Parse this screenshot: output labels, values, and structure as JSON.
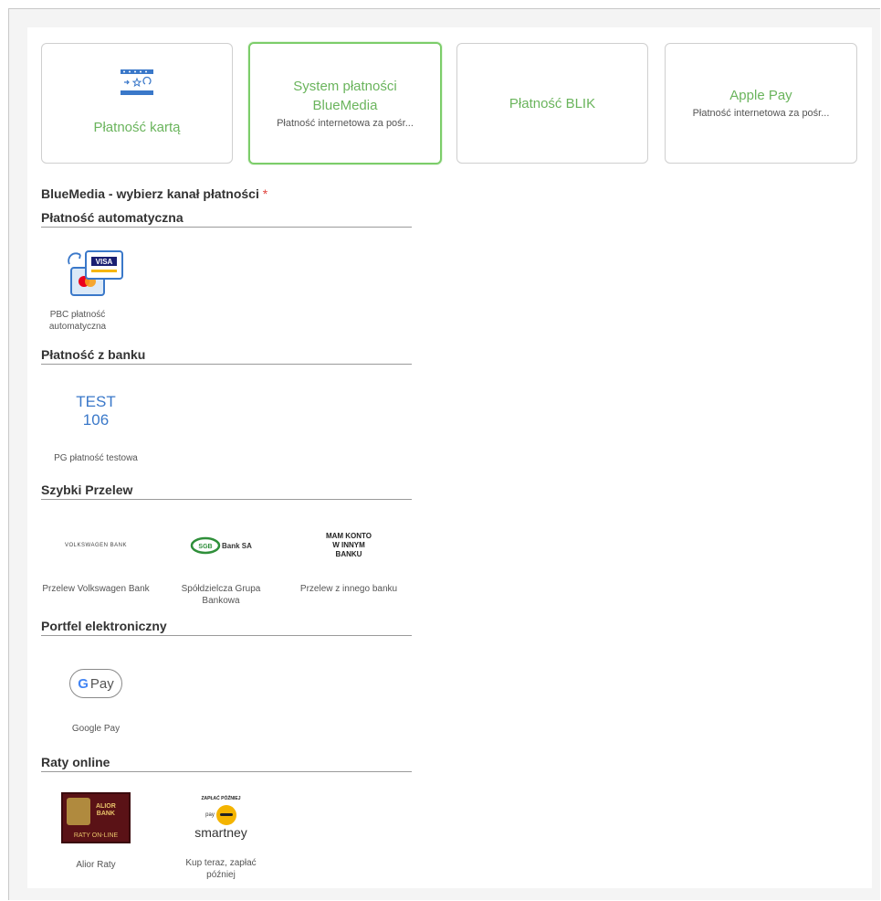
{
  "tiles": [
    {
      "title": "Płatność kartą",
      "subtitle": ""
    },
    {
      "title": "System płatności BlueMedia",
      "subtitle": "Płatność internetowa za pośr..."
    },
    {
      "title": "Płatność BLIK",
      "subtitle": ""
    },
    {
      "title": "Apple Pay",
      "subtitle": "Płatność internetowa za pośr..."
    }
  ],
  "selected_tile": "System płatności BlueMedia",
  "channel_label": "BlueMedia - wybierz kanał płatności",
  "required_mark": "*",
  "sections": {
    "auto": {
      "title": "Płatność automatyczna",
      "items": [
        {
          "label": "PBC płatność automatyczna",
          "logo_text": "VISA"
        }
      ]
    },
    "bank": {
      "title": "Płatność z banku",
      "items": [
        {
          "label": "PG płatność testowa",
          "logo_line1": "TEST",
          "logo_line2": "106"
        }
      ]
    },
    "fast": {
      "title": "Szybki Przelew",
      "items": [
        {
          "label": "Przelew Volkswagen Bank",
          "logo_text": "VOLKSWAGEN BANK"
        },
        {
          "label": "Spółdzielcza Grupa Bankowa",
          "logo_text": "Bank SA"
        },
        {
          "label": "Przelew z innego banku",
          "logo_line1": "MAM KONTO",
          "logo_line2": "W INNYM",
          "logo_line3": "BANKU"
        }
      ]
    },
    "wallet": {
      "title": "Portfel elektroniczny",
      "items": [
        {
          "label": "Google Pay",
          "logo_text": "Pay"
        }
      ]
    },
    "installments": {
      "title": "Raty online",
      "items": [
        {
          "label": "Alior Raty",
          "logo_line1": "ALIOR",
          "logo_line2": "BANK",
          "logo_line3": "RATY ON-LINE"
        },
        {
          "label": "Kup teraz, zapłać później",
          "logo_top": "ZAPŁAĆ PÓŹNIEJ",
          "logo_small": "pay",
          "logo_text": "smartney"
        }
      ]
    }
  },
  "colors": {
    "accent_green": "#6ab45c",
    "selected_border": "#7ccd6a",
    "required_red": "#e0443e"
  }
}
